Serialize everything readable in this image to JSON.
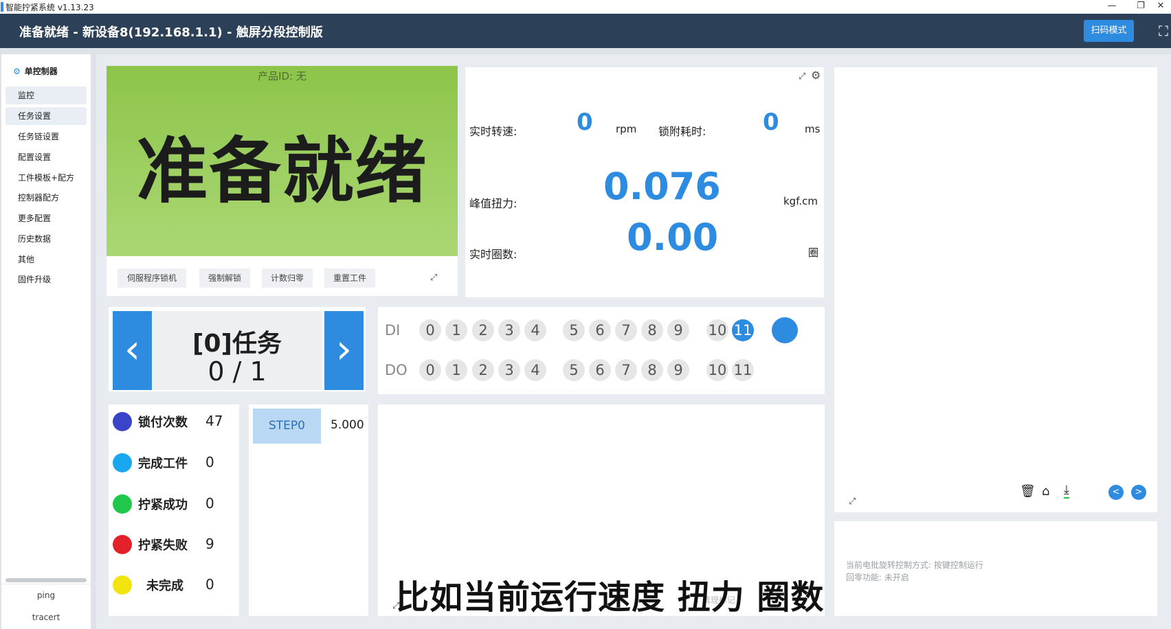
{
  "window": {
    "title": "智能拧紧系统 v1.13.23",
    "minimize": "—",
    "restore": "❐",
    "close": "✕"
  },
  "header": {
    "title": "准备就绪 - 新设备8(192.168.1.1) - 触屏分段控制版",
    "scan_mode": "扫码模式",
    "fullscreen_icon": "⛶"
  },
  "sidebar": {
    "heading": "单控制器",
    "items": [
      {
        "label": "监控"
      },
      {
        "label": "任务设置"
      },
      {
        "label": "任务链设置"
      },
      {
        "label": "配置设置"
      },
      {
        "label": "工件模板+配方"
      },
      {
        "label": "控制器配方"
      },
      {
        "label": "更多配置"
      },
      {
        "label": "历史数据"
      },
      {
        "label": "其他"
      },
      {
        "label": "固件升级"
      }
    ],
    "tools": [
      "ping",
      "tracert"
    ]
  },
  "status": {
    "product_id": "产品ID: 无",
    "state": "准备就绪",
    "color_top": "#8cc54a",
    "color_bottom": "#abd774"
  },
  "actions": {
    "servo_lock": "伺服程序锁机",
    "force_unlock": "强制解锁",
    "count_reset": "计数归零",
    "reset_workpiece": "重置工件"
  },
  "realtime": {
    "speed_label": "实时转速:",
    "speed_value": "0",
    "speed_unit": "rpm",
    "lock_time_label": "锁附耗时:",
    "lock_time_value": "0",
    "lock_time_unit": "ms",
    "peak_torque_label": "峰值扭力:",
    "peak_torque_value": "0.076",
    "torque_unit": "kgf.cm",
    "turns_label": "实时圈数:",
    "turns_value": "0.00",
    "turns_unit": "圈"
  },
  "task": {
    "name": "[0]任务",
    "progress": "0 / 1",
    "prev": "‹",
    "next": "›"
  },
  "io": {
    "di_label": "DI",
    "do_label": "DO",
    "di": [
      {
        "n": "0",
        "on": false
      },
      {
        "n": "1",
        "on": false
      },
      {
        "n": "2",
        "on": false
      },
      {
        "n": "3",
        "on": false
      },
      {
        "n": "4",
        "on": false
      },
      {
        "n": "5",
        "on": false
      },
      {
        "n": "6",
        "on": false
      },
      {
        "n": "7",
        "on": false
      },
      {
        "n": "8",
        "on": false
      },
      {
        "n": "9",
        "on": false
      },
      {
        "n": "10",
        "on": false
      },
      {
        "n": "11",
        "on": true
      },
      {
        "n": "",
        "on": true
      }
    ],
    "do": [
      {
        "n": "0",
        "on": false
      },
      {
        "n": "1",
        "on": false
      },
      {
        "n": "2",
        "on": false
      },
      {
        "n": "3",
        "on": false
      },
      {
        "n": "4",
        "on": false
      },
      {
        "n": "5",
        "on": false
      },
      {
        "n": "6",
        "on": false
      },
      {
        "n": "7",
        "on": false
      },
      {
        "n": "8",
        "on": false
      },
      {
        "n": "9",
        "on": false
      },
      {
        "n": "10",
        "on": false
      },
      {
        "n": "11",
        "on": false
      }
    ]
  },
  "counters": [
    {
      "label": "锁付次数",
      "value": "47",
      "color": "#3b44c9"
    },
    {
      "label": "完成工件",
      "value": "0",
      "color": "#19a8f0"
    },
    {
      "label": "拧紧成功",
      "value": "0",
      "color": "#1fc84a"
    },
    {
      "label": "拧紧失败",
      "value": "9",
      "color": "#e3212b"
    },
    {
      "label": "未完成",
      "value": "0",
      "color": "#f2e40f"
    }
  ],
  "steps": {
    "step_label": "STEP0",
    "step_value": "5.000"
  },
  "graph": {
    "faint_label": "清理标记"
  },
  "chart_tools": {
    "delete_icon": "🗑",
    "basket_icon": "⌂",
    "download_icon": "⤓",
    "prev": "<",
    "next": ">"
  },
  "info": {
    "line1": "当前电批旋转控制方式: 按键控制运行",
    "line2": "回零功能: 未开启"
  },
  "subtitle": "比如当前运行速度 扭力 圈数",
  "colors": {
    "accent": "#2d8be0",
    "header": "#2c4158"
  }
}
